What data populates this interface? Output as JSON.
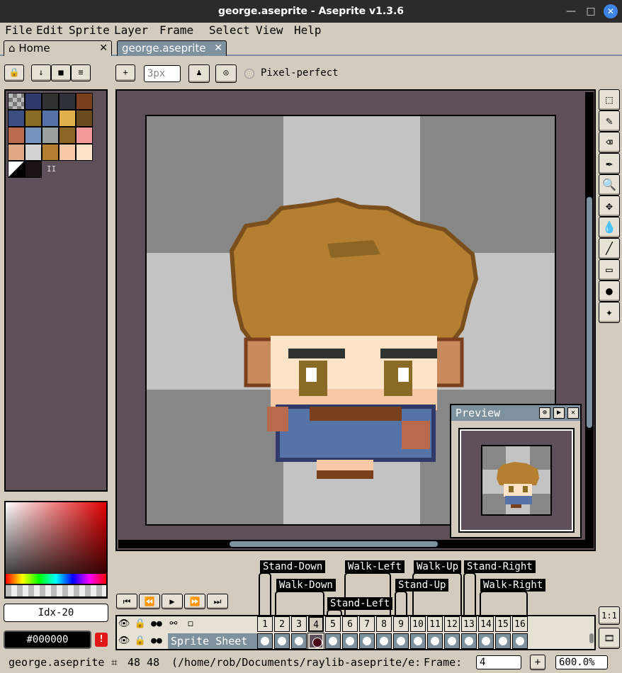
{
  "window": {
    "title": "george.aseprite - Aseprite v1.3.6",
    "minimize": "—",
    "maximize": "□",
    "close": "✕"
  },
  "menu": [
    "File",
    "Edit",
    "Sprite",
    "Layer",
    "Frame",
    "Select",
    "View",
    "Help"
  ],
  "tabs": {
    "home": "Home",
    "file": "george.aseprite",
    "close": "✕"
  },
  "toolbar": {
    "lock": "🔒",
    "down": "↓",
    "square": "■",
    "list": "≡",
    "plus": "+",
    "brush_size": "3px",
    "ink": "♟",
    "target": "◎",
    "pixel_perfect": "Pixel-perfect"
  },
  "palette": {
    "colors": [
      "#9a9a9a",
      "#2f3a6b",
      "#2f3330",
      "#2d3238",
      "#7a3f1c",
      "#3d4f80",
      "#8a6b26",
      "#5673a8",
      "#e0b04a",
      "#6b4a1c",
      "#b86a4a",
      "#7594bb",
      "#9aa09e",
      "#8b6524",
      "#f39a9a",
      "#e0a884",
      "#d3d3cf",
      "#b57f31",
      "#f6caa6",
      "#fde4c8"
    ],
    "extra": "II"
  },
  "color_bar": {
    "index": "Idx-20",
    "hex": "#000000",
    "warning": "!"
  },
  "canvas": {
    "checker_light": "#c3c3c3",
    "checker_dark": "#878787"
  },
  "preview": {
    "title": "Preview",
    "btn_pin": "⊕",
    "btn_play": "▶",
    "btn_close": "✕"
  },
  "tools": [
    "⬚",
    "✎",
    "⌫",
    "✒",
    "🔍",
    "✥",
    "💧",
    "╱",
    "▭",
    "●",
    "✦"
  ],
  "tags": {
    "stand_down": "Stand-Down",
    "walk_down": "Walk-Down",
    "walk_left": "Walk-Left",
    "stand_left": "Stand-Left",
    "walk_up": "Walk-Up",
    "stand_up": "Stand-Up",
    "stand_right": "Stand-Right",
    "walk_right": "Walk-Right"
  },
  "playback": [
    "⏮",
    "⏪",
    "▶",
    "⏩",
    "⏭"
  ],
  "timeline": {
    "frames": [
      "1",
      "2",
      "3",
      "4",
      "5",
      "6",
      "7",
      "8",
      "9",
      "10",
      "11",
      "12",
      "13",
      "14",
      "15",
      "16"
    ],
    "active_frame_index": 3,
    "layer_name": "Sprite Sheet",
    "header_icons": {
      "eye": "👁",
      "lock": "🔒",
      "onion": "●●",
      "link": "⚯",
      "square": "◻"
    },
    "onion_btn": "1:1",
    "film_btn": "🎞"
  },
  "status": {
    "filename": "george.aseprite",
    "size": "48 48",
    "path": "(/home/rob/Documents/raylib-aseprite/e:",
    "frame_label": "Frame:",
    "frame_value": "4",
    "plus": "+",
    "zoom": "600.0%"
  }
}
